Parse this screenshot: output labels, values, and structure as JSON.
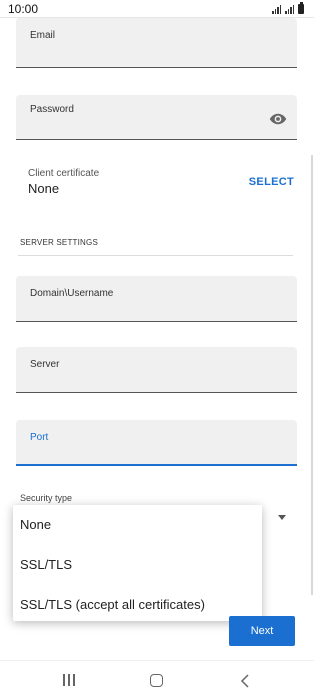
{
  "status_bar": {
    "time": "10:00"
  },
  "form": {
    "email_label": "Email",
    "password_label": "Password",
    "client_certificate": {
      "label": "Client certificate",
      "value": "None",
      "select_label": "SELECT"
    },
    "server_settings_header": "SERVER SETTINGS",
    "domain_username_label": "Domain\\Username",
    "server_label": "Server",
    "port_label": "Port",
    "security_type_label": "Security type"
  },
  "security_type_menu": {
    "options": [
      "None",
      "SSL/TLS",
      "SSL/TLS (accept all certificates)"
    ]
  },
  "next_button_label": "Next",
  "colors": {
    "accent": "#1a6fd1",
    "field_bg": "#f0f0f0"
  }
}
